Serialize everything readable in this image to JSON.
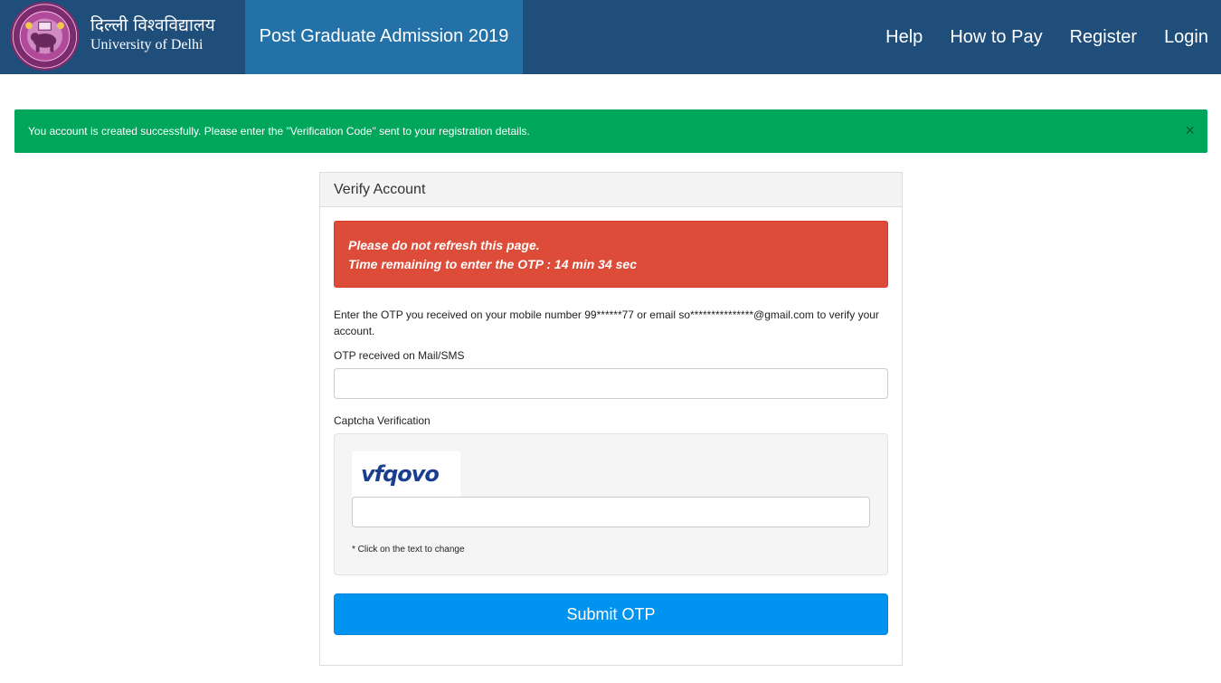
{
  "header": {
    "brand_hindi": "दिल्ली विश्वविद्यालय",
    "brand_english": "University of Delhi",
    "title": "Post Graduate Admission 2019",
    "nav": [
      {
        "label": "Help"
      },
      {
        "label": "How to Pay"
      },
      {
        "label": "Register"
      },
      {
        "label": "Login"
      }
    ]
  },
  "success_alert": {
    "message": "You account is created successfully. Please enter the \"Verification Code\" sent to your registration details.",
    "close_glyph": "×"
  },
  "panel": {
    "heading": "Verify Account",
    "warning_line1": "Please do not refresh this page.",
    "warning_line2": "Time remaining to enter the OTP : 14 min 34 sec",
    "instructions": "Enter the OTP you received on your mobile number 99******77 or email so***************@gmail.com to verify your account.",
    "otp_label": "OTP received on Mail/SMS",
    "otp_value": "",
    "captcha_label": "Captcha Verification",
    "captcha_text": "vfqovo",
    "captcha_value": "",
    "captcha_hint": "* Click on the text to change",
    "submit_label": "Submit OTP"
  },
  "colors": {
    "navbar": "#1f4e7b",
    "nav_title_bg": "#2471a8",
    "success": "#00a65a",
    "danger": "#dd4b39",
    "primary": "#0094f0"
  }
}
